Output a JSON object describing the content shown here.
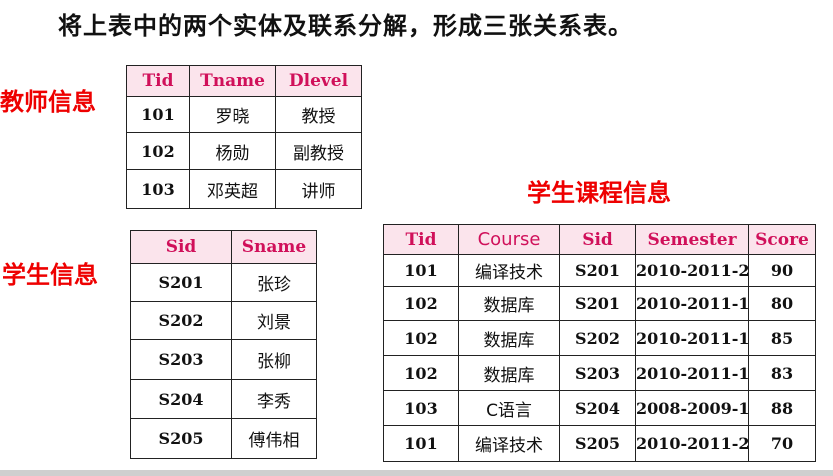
{
  "heading": "将上表中的两个实体及联系分解，形成三张关系表。",
  "teacher_section": {
    "label": "教师信息",
    "headers": [
      "Tid",
      "Tname",
      "Dlevel"
    ],
    "rows": [
      [
        "101",
        "罗晓",
        "教授"
      ],
      [
        "102",
        "杨勋",
        "副教授"
      ],
      [
        "103",
        "邓英超",
        "讲师"
      ]
    ]
  },
  "student_section": {
    "label": "学生信息",
    "headers": [
      "Sid",
      "Sname"
    ],
    "rows": [
      [
        "S201",
        "张珍"
      ],
      [
        "S202",
        "刘景"
      ],
      [
        "S203",
        "张柳"
      ],
      [
        "S204",
        "李秀"
      ],
      [
        "S205",
        "傅伟相"
      ]
    ]
  },
  "course_section": {
    "label": "学生课程信息",
    "headers": [
      "Tid",
      "Course",
      "Sid",
      "Semester",
      "Score"
    ],
    "rows": [
      [
        "101",
        "编译技术",
        "S201",
        "2010-2011-2",
        "90"
      ],
      [
        "102",
        "数据库",
        "S201",
        "2010-2011-1",
        "80"
      ],
      [
        "102",
        "数据库",
        "S202",
        "2010-2011-1",
        "85"
      ],
      [
        "102",
        "数据库",
        "S203",
        "2010-2011-1",
        "83"
      ],
      [
        "103",
        "C语言",
        "S204",
        "2008-2009-1",
        "88"
      ],
      [
        "101",
        "编译技术",
        "S205",
        "2010-2011-2",
        "70"
      ]
    ]
  },
  "colors": {
    "label_red": "#ee0000",
    "header_text": "#d0105a",
    "header_bg": "#fbe4ec"
  }
}
